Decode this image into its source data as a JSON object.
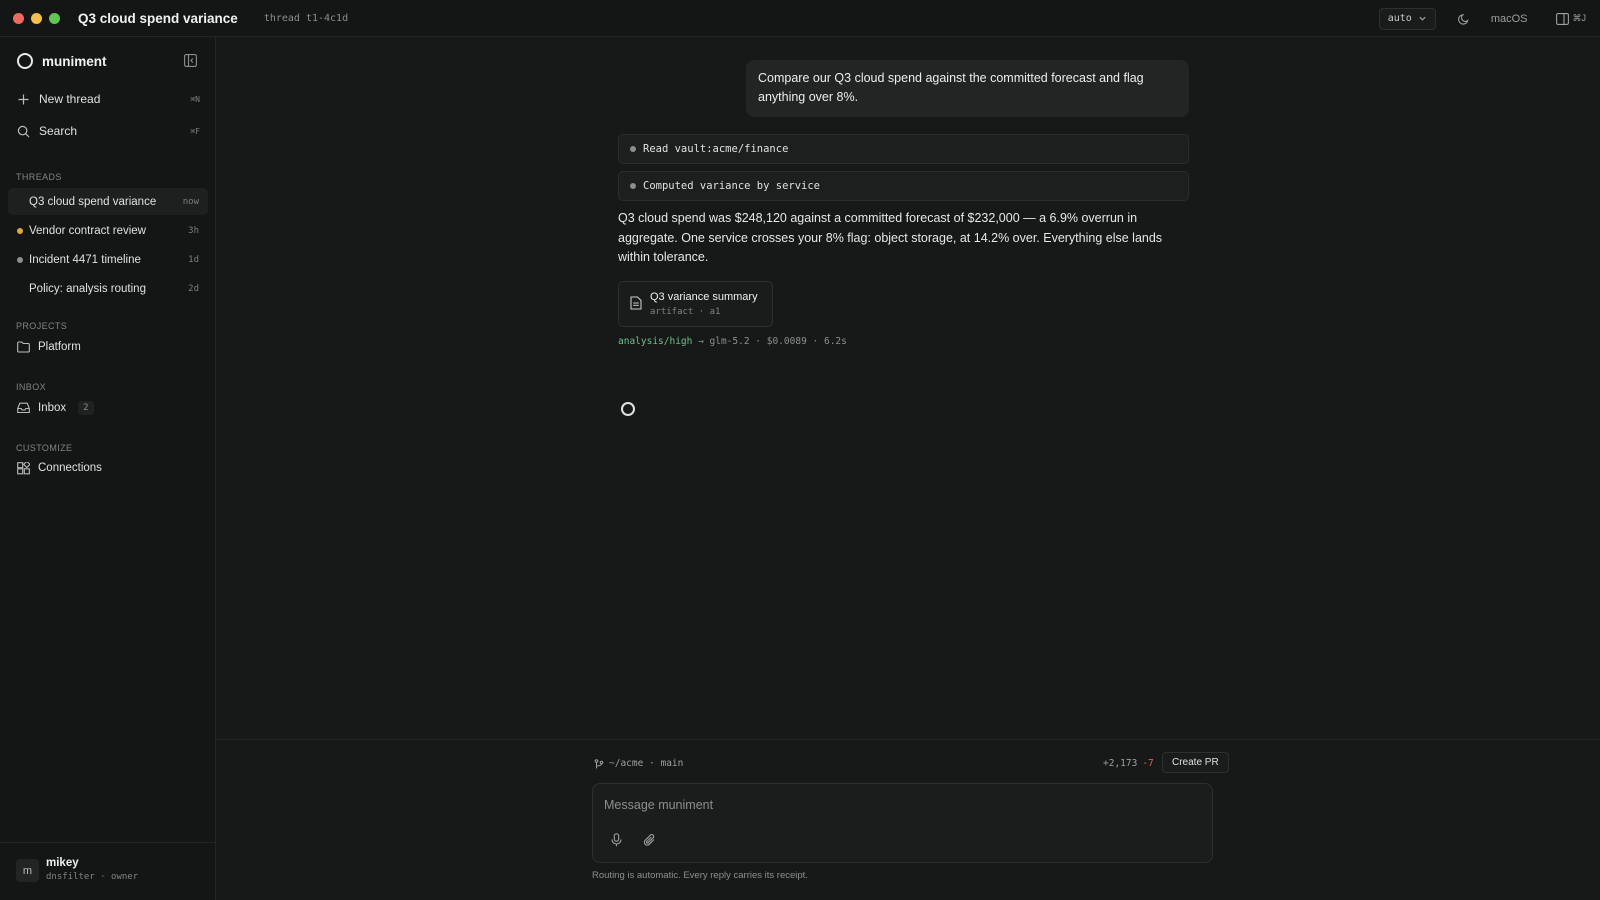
{
  "window": {
    "title": "Q3 cloud spend variance",
    "thread_id": "thread t1-4c1d",
    "traffic_lights": [
      "#ed6a5e",
      "#f5bf4f",
      "#61c554"
    ],
    "mode_select": "auto",
    "platform": "macOS",
    "panel_shortcut": "⌘J"
  },
  "sidebar": {
    "brand": "muniment",
    "actions": [
      {
        "label": "New thread",
        "shortcut": "⌘N",
        "icon": "plus-icon"
      },
      {
        "label": "Search",
        "shortcut": "⌘F",
        "icon": "search-icon"
      }
    ],
    "threads_label": "THREADS",
    "threads": [
      {
        "title": "Q3 cloud spend variance",
        "time": "now",
        "dot": ""
      },
      {
        "title": "Vendor contract review",
        "time": "3h",
        "dot": "#e0a93a"
      },
      {
        "title": "Incident 4471 timeline",
        "time": "1d",
        "dot": "#8a8f8c"
      },
      {
        "title": "Policy: analysis routing",
        "time": "2d",
        "dot": ""
      }
    ],
    "projects_label": "PROJECTS",
    "projects": [
      {
        "label": "Platform",
        "icon": "folder-icon"
      }
    ],
    "inbox_label": "INBOX",
    "inbox": {
      "label": "Inbox",
      "count": "2",
      "icon": "inbox-icon"
    },
    "customize_label": "CUSTOMIZE",
    "connections": {
      "label": "Connections",
      "icon": "connections-icon"
    },
    "user": {
      "initial": "m",
      "name": "mikey",
      "org": "dnsfilter · owner"
    }
  },
  "conversation": {
    "user_message": "Compare our Q3 cloud spend against the committed forecast and flag anything over 8%.",
    "tool_steps": [
      "Read vault:acme/finance",
      "Computed variance by service"
    ],
    "answer": "Q3 cloud spend was $248,120 against a committed forecast of $232,000 — a 6.9% overrun in aggregate. One service crosses your 8% flag: object storage, at 14.2% over. Everything else lands within tolerance.",
    "artifact": {
      "title": "Q3 variance summary",
      "subtitle": "artifact · a1",
      "icon": "document-icon"
    },
    "receipt": {
      "route": "analysis/high",
      "arrow": " → ",
      "model": "glm-5.2",
      "cost": "$0.0089",
      "latency": "6.2s",
      "sep": " · "
    }
  },
  "composer": {
    "branch": "~/acme · main",
    "additions": "+2,173",
    "deletions": "-7",
    "create_pr": "Create PR",
    "placeholder": "Message muniment",
    "footnote": "Routing is automatic. Every reply carries its receipt."
  }
}
